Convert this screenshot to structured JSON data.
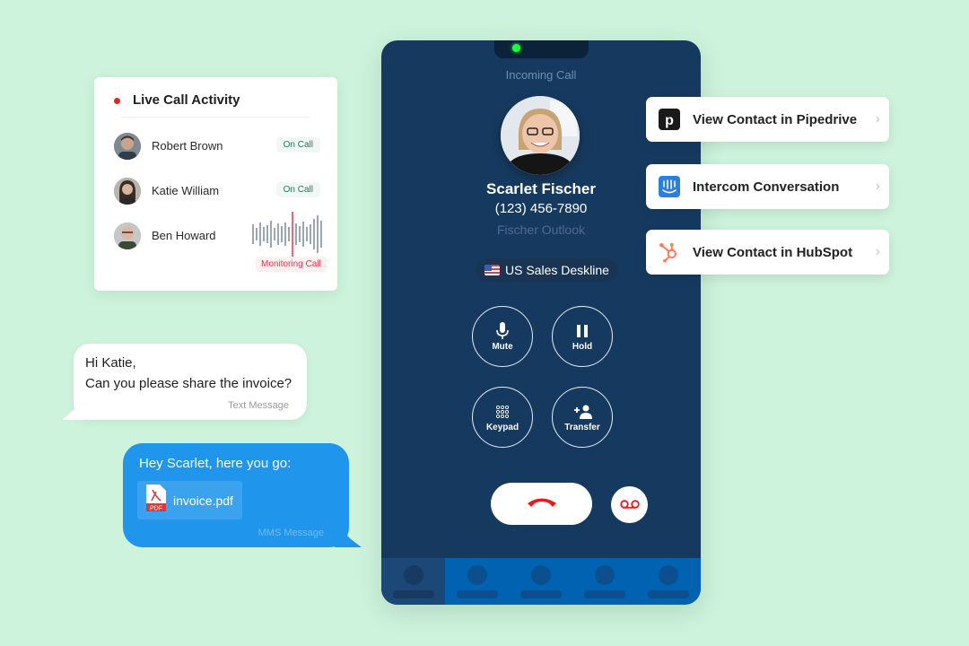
{
  "live_activity": {
    "title": "Live Call Activity",
    "agents": [
      {
        "name": "Robert Brown",
        "status": "On Call"
      },
      {
        "name": "Katie William",
        "status": "On Call"
      },
      {
        "name": "Ben Howard",
        "status": "Monitoring Call"
      }
    ]
  },
  "phone": {
    "header": "Incoming Call",
    "caller": {
      "name": "Scarlet Fischer",
      "phone": "(123) 456-7890",
      "company": "Fischer Outlook"
    },
    "line": "US Sales Deskline",
    "controls": [
      {
        "label": "Mute",
        "icon": "microphone-icon"
      },
      {
        "label": "Hold",
        "icon": "pause-icon"
      },
      {
        "label": "Keypad",
        "icon": "keypad-icon"
      },
      {
        "label": "Transfer",
        "icon": "add-person-icon"
      }
    ],
    "end_call_icon": "hang-up-icon",
    "voicemail_icon": "voicemail-icon",
    "colors": {
      "end_call": "#e81b1b",
      "background": "#163a5f",
      "tabbar": "#0062b0"
    }
  },
  "integrations": [
    {
      "label": "View Contact in Pipedrive",
      "icon": "pipedrive-icon"
    },
    {
      "label": "Intercom Conversation",
      "icon": "intercom-icon"
    },
    {
      "label": "View Contact in HubSpot",
      "icon": "hubspot-icon"
    }
  ],
  "messages": {
    "incoming": {
      "line1": "Hi Katie,",
      "line2": "Can you please share the invoice?",
      "type": "Text Message"
    },
    "outgoing": {
      "text": "Hey Scarlet, here you go:",
      "attachment": "invoice.pdf",
      "attachment_badge": "PDF",
      "type": "MMS Message"
    }
  }
}
